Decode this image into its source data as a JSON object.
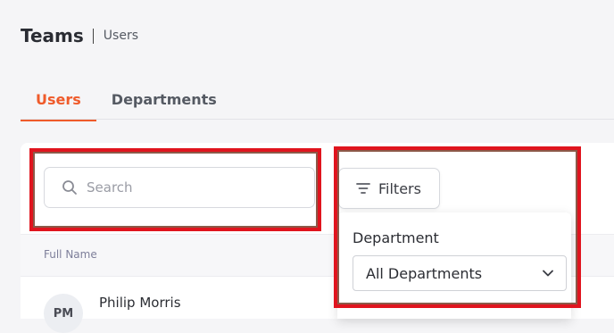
{
  "header": {
    "title": "Teams",
    "breadcrumb": "Users"
  },
  "tabs": [
    {
      "label": "Users",
      "active": true
    },
    {
      "label": "Departments",
      "active": false
    }
  ],
  "search": {
    "placeholder": "Search",
    "icon": "search-icon"
  },
  "filters": {
    "button_label": "Filters",
    "icon": "filter-lines-icon",
    "department": {
      "label": "Department",
      "selected": "All Departments"
    }
  },
  "table": {
    "columns": [
      "Full Name"
    ],
    "rows": [
      {
        "initials": "PM",
        "name": "Philip Morris"
      }
    ]
  },
  "colors": {
    "accent": "#ef5b2b",
    "highlight": "#e0141e"
  }
}
